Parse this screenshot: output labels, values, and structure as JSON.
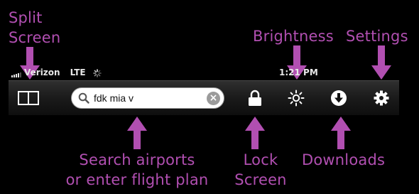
{
  "status_bar": {
    "carrier": "Verizon",
    "network": "LTE",
    "time": "1:21 PM"
  },
  "toolbar": {
    "search_value": "fdk mia v",
    "buttons": [
      {
        "name": "split-screen",
        "icon": "split-screen-icon"
      },
      {
        "name": "lock-screen",
        "icon": "lock-icon"
      },
      {
        "name": "brightness",
        "icon": "sun-icon"
      },
      {
        "name": "downloads",
        "icon": "download-arrow-icon"
      },
      {
        "name": "settings",
        "icon": "gear-icon"
      }
    ]
  },
  "callouts": {
    "split_screen": [
      "Split",
      "Screen"
    ],
    "brightness": "Brightness",
    "settings": "Settings",
    "search": [
      "Search airports",
      "or enter flight plan"
    ],
    "lock": [
      "Lock",
      "Screen"
    ],
    "downloads": "Downloads"
  },
  "colors": {
    "callout": "#b14fb1",
    "background": "#000000",
    "toolbar": "#1c1c1c"
  }
}
